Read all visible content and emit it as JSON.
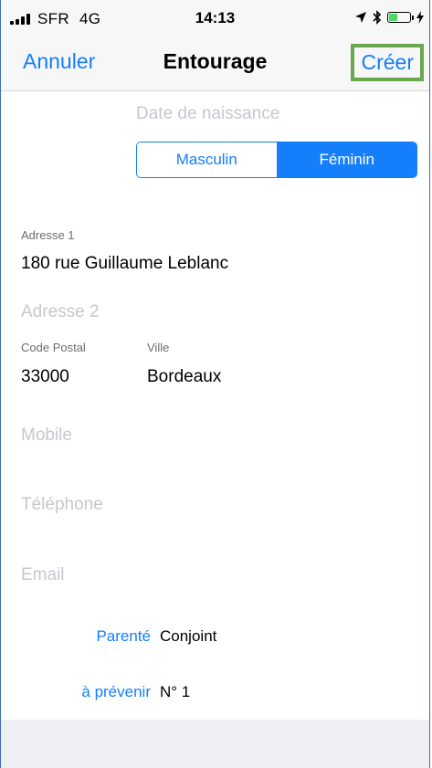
{
  "status_bar": {
    "carrier": "SFR",
    "network": "4G",
    "time": "14:13",
    "icons": [
      "signal-bars-icon",
      "location-arrow-icon",
      "bluetooth-icon",
      "battery-icon",
      "charging-bolt-icon"
    ],
    "battery_level": 0.4
  },
  "nav": {
    "cancel_label": "Annuler",
    "title": "Entourage",
    "create_label": "Créer",
    "create_highlight_color": "#6aa84f"
  },
  "form": {
    "birthdate_placeholder": "Date de naissance",
    "gender": {
      "options": [
        "Masculin",
        "Féminin"
      ],
      "selected": "Féminin"
    },
    "address1": {
      "label": "Adresse 1",
      "value": "180 rue Guillaume Leblanc"
    },
    "address2": {
      "placeholder": "Adresse 2"
    },
    "postal_code": {
      "label": "Code Postal",
      "value": "33000"
    },
    "city": {
      "label": "Ville",
      "value": "Bordeaux"
    },
    "mobile": {
      "placeholder": "Mobile"
    },
    "phone": {
      "placeholder": "Téléphone"
    },
    "email": {
      "placeholder": "Email"
    },
    "relation": {
      "label": "Parenté",
      "value": "Conjoint"
    },
    "notify": {
      "label": "à prévenir",
      "value": "N° 1"
    }
  },
  "colors": {
    "accent": "#157efb",
    "placeholder": "#c7c7cd",
    "label": "#6d6d72",
    "nav_background": "#f7f7f7",
    "footer_background": "#efeff4"
  }
}
